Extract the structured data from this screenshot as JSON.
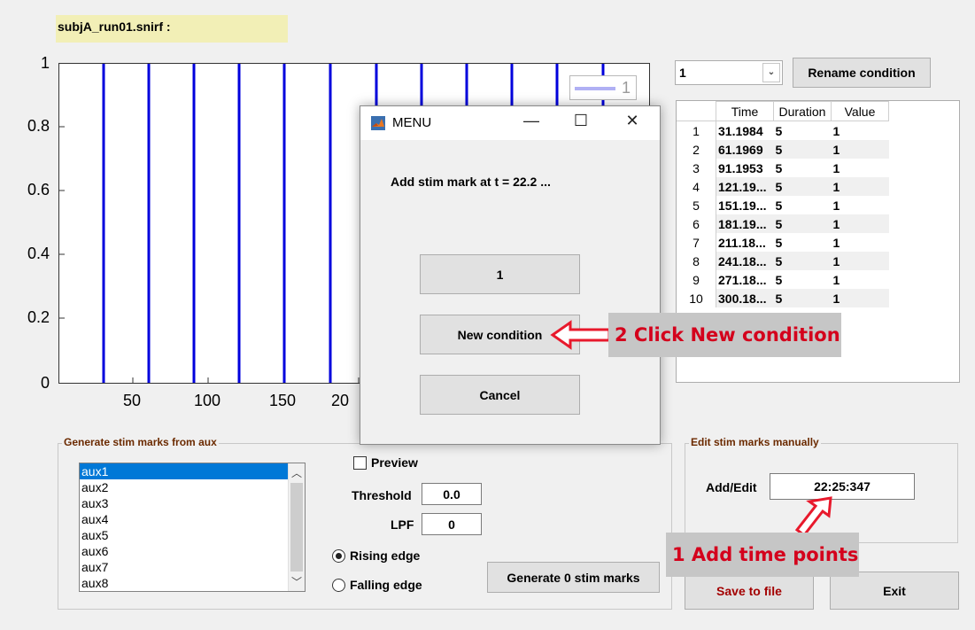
{
  "file_title": "subjA_run01.snirf :",
  "plot": {
    "y_ticks": [
      "1",
      "0.8",
      "0.6",
      "0.4",
      "0.2",
      "0"
    ],
    "x_ticks": [
      "50",
      "100",
      "150",
      "20"
    ],
    "legend_label": "1",
    "line_color": "#0000dd"
  },
  "condition_select": {
    "value": "1",
    "arrow": "⌄"
  },
  "rename_button": "Rename condition",
  "table": {
    "headers": [
      "",
      "Time",
      "Duration",
      "Value"
    ],
    "rows": [
      [
        "1",
        "31.1984",
        "5",
        "1"
      ],
      [
        "2",
        "61.1969",
        "5",
        "1"
      ],
      [
        "3",
        "91.1953",
        "5",
        "1"
      ],
      [
        "4",
        "121.19...",
        "5",
        "1"
      ],
      [
        "5",
        "151.19...",
        "5",
        "1"
      ],
      [
        "6",
        "181.19...",
        "5",
        "1"
      ],
      [
        "7",
        "211.18...",
        "5",
        "1"
      ],
      [
        "8",
        "241.18...",
        "5",
        "1"
      ],
      [
        "9",
        "271.18...",
        "5",
        "1"
      ],
      [
        "10",
        "300.18...",
        "5",
        "1"
      ]
    ]
  },
  "aux_panel": {
    "title": "Generate stim marks from aux",
    "items": [
      "aux1",
      "aux2",
      "aux3",
      "aux4",
      "aux5",
      "aux6",
      "aux7",
      "aux8"
    ],
    "selected_index": 0,
    "preview_label": "Preview",
    "threshold_label": "Threshold",
    "threshold_value": "0.0",
    "lpf_label": "LPF",
    "lpf_value": "0",
    "rising_label": "Rising edge",
    "falling_label": "Falling edge",
    "generate_button": "Generate 0 stim marks"
  },
  "manual_panel": {
    "title": "Edit stim marks manually",
    "add_edit_label": "Add/Edit",
    "add_edit_value": "22:25:347"
  },
  "save_button": "Save to file",
  "exit_button": "Exit",
  "dialog": {
    "title": "MENU",
    "message": "Add stim mark at  t = 22.2  ...",
    "option_button": "1",
    "new_condition_button": "New condition",
    "cancel_button": "Cancel",
    "minimize": "—",
    "maximize": "☐",
    "close": "✕"
  },
  "annotations": {
    "step2": "2 Click New condition",
    "step1": "1 Add time points",
    "color": "#e8192c"
  }
}
